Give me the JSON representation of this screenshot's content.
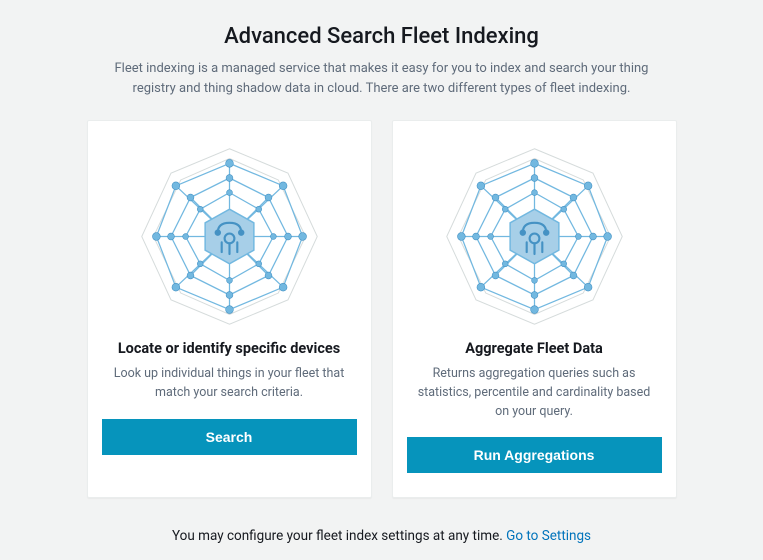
{
  "header": {
    "title": "Advanced Search Fleet Indexing",
    "description": "Fleet indexing is a managed service that makes it easy for you to index and search your thing registry and thing shadow data in cloud. There are two different types of fleet indexing."
  },
  "cards": {
    "search": {
      "title": "Locate or identify specific devices",
      "description": "Look up individual things in your fleet that match your search criteria.",
      "button": "Search"
    },
    "aggregate": {
      "title": "Aggregate Fleet Data",
      "description": "Returns aggregation queries such as statistics, percentile and cardinality based on your query.",
      "button": "Run Aggregations"
    }
  },
  "footer": {
    "text": "You may configure your fleet index settings at any time.",
    "link": "Go to Settings"
  }
}
